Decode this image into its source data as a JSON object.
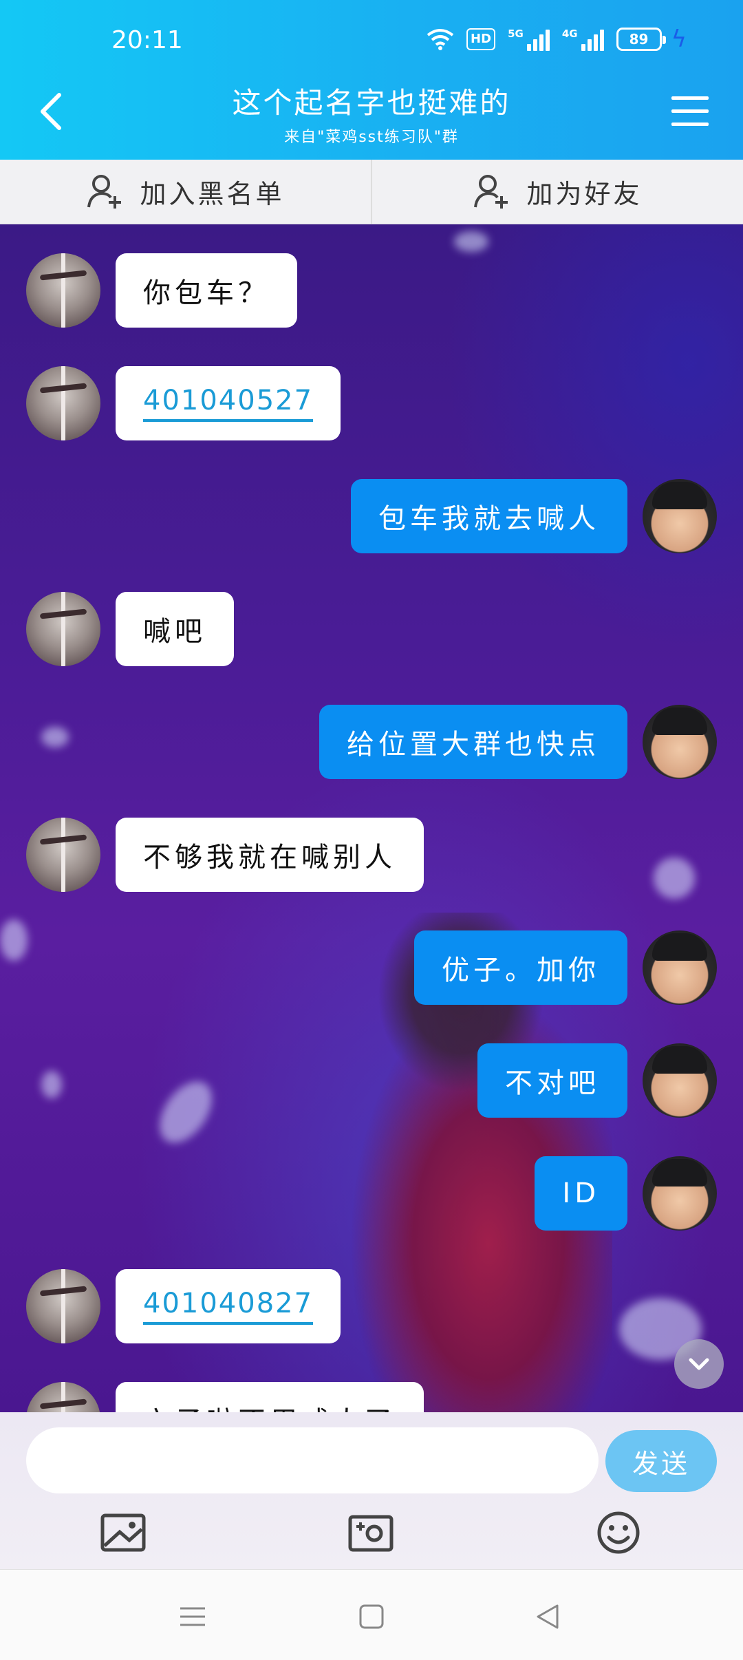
{
  "status": {
    "time": "20:11",
    "hd_label": "HD",
    "net1": "5G",
    "net2": "4G",
    "battery": "89"
  },
  "header": {
    "title": "这个起名字也挺难的",
    "subtitle": "来自\"菜鸡sst练习队\"群"
  },
  "actions": {
    "blacklist": "加入黑名单",
    "add_friend": "加为好友"
  },
  "messages": [
    {
      "from": "other",
      "text": "你包车？"
    },
    {
      "from": "other",
      "text": "401040527",
      "link": true
    },
    {
      "from": "me",
      "text": "包车我就去喊人"
    },
    {
      "from": "other",
      "text": "喊吧"
    },
    {
      "from": "me",
      "text": "给位置大群也快点"
    },
    {
      "from": "other",
      "text": "不够我就在喊别人"
    },
    {
      "from": "me",
      "text": "优子。加你"
    },
    {
      "from": "me",
      "text": "不对吧"
    },
    {
      "from": "me",
      "text": "ID"
    },
    {
      "from": "other",
      "text": "401040827",
      "link": true
    },
    {
      "from": "other",
      "text": "六子啦不用咸人了"
    }
  ],
  "composer": {
    "placeholder": "",
    "send_label": "发送"
  },
  "icons": {
    "back": "chevron-left-icon",
    "menu": "menu-icon",
    "photo": "image-icon",
    "camera": "camera-icon",
    "emoji": "emoji-icon"
  },
  "colors": {
    "header_start": "#14c8f5",
    "header_end": "#1aa2ef",
    "my_bubble": "#0a8ef2",
    "send_button": "#6cc5f3",
    "link": "#1a9bd6"
  }
}
